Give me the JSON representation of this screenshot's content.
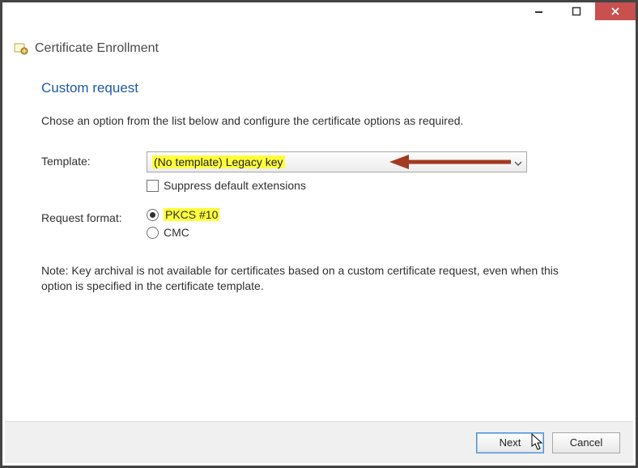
{
  "window": {
    "title": "Certificate Enrollment"
  },
  "section": {
    "heading": "Custom request",
    "instruction": "Chose an option from the list below and configure the certificate options as required."
  },
  "form": {
    "template": {
      "label": "Template:",
      "selected": "(No template) Legacy key",
      "suppress_label": "Suppress default extensions",
      "suppress_checked": false
    },
    "request_format": {
      "label": "Request format:",
      "options": [
        {
          "label": "PKCS #10",
          "checked": true,
          "highlight": true
        },
        {
          "label": "CMC",
          "checked": false,
          "highlight": false
        }
      ]
    }
  },
  "note": "Note: Key archival is not available for certificates based on a custom certificate request, even when this option is specified in the certificate template.",
  "footer": {
    "next": "Next",
    "cancel": "Cancel"
  },
  "annotations": {
    "arrow_color": "#a23920"
  }
}
